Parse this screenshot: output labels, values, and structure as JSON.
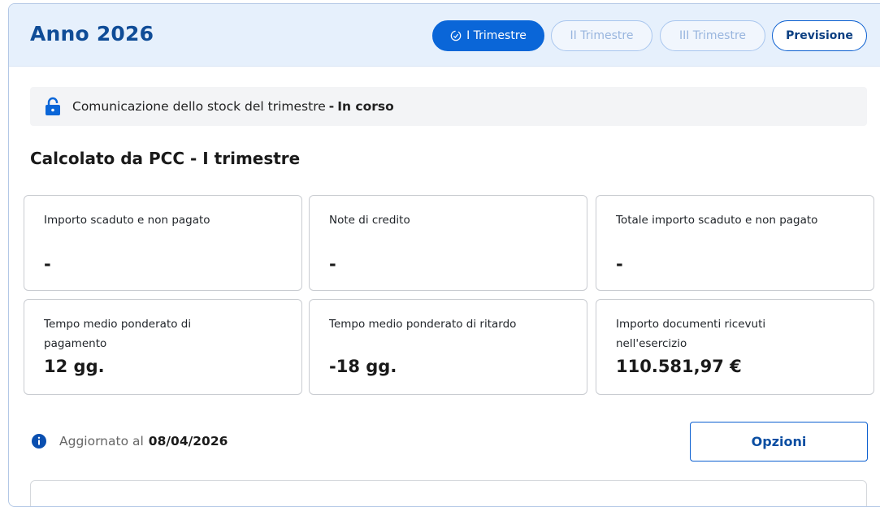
{
  "header": {
    "year_title": "Anno 2026",
    "tabs": [
      {
        "label": "I Trimestre",
        "state": "active",
        "icon": "check-circle-icon"
      },
      {
        "label": "II Trimestre",
        "state": "disabled"
      },
      {
        "label": "III Trimestre",
        "state": "disabled"
      },
      {
        "label": "Previsione",
        "state": "normal"
      }
    ]
  },
  "status": {
    "icon": "lock-icon",
    "text": "Comunicazione dello stock del trimestre",
    "separator": "-",
    "state": "In corso"
  },
  "section": {
    "title": "Calcolato da PCC - I trimestre"
  },
  "cards": [
    {
      "label": "Importo scaduto e non pagato",
      "value": "-"
    },
    {
      "label": "Note di credito",
      "value": "-"
    },
    {
      "label": "Totale importo scaduto e non pagato",
      "value": "-"
    },
    {
      "label": "Tempo medio ponderato di pagamento",
      "value": "12 gg."
    },
    {
      "label": "Tempo medio ponderato di ritardo",
      "value": "-18 gg."
    },
    {
      "label": "Importo documenti ricevuti nell'esercizio",
      "value": "110.581,97 €"
    }
  ],
  "footer": {
    "info_icon": "info-circle-icon",
    "updated_label": "Aggiornato al",
    "updated_date": "08/04/2026",
    "options_label": "Opzioni"
  },
  "colors": {
    "primary": "#0a66d8",
    "header_bg": "#e6f0fc",
    "title": "#0f4c97"
  }
}
